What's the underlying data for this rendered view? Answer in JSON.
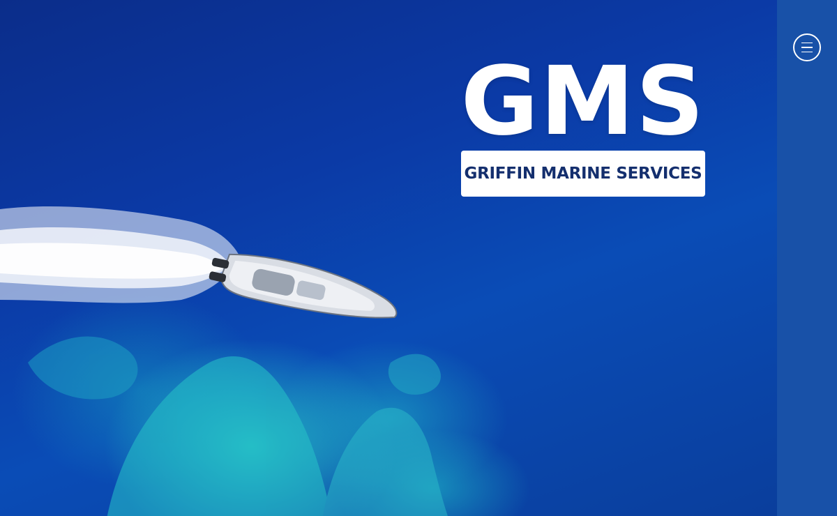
{
  "logo": {
    "mark": "GMS",
    "tagline": "GRIFFIN MARINE SERVICES"
  },
  "hero": {
    "image": "aerial-speedboat-ocean"
  },
  "nav": {
    "menu_icon": "hamburger-menu-icon"
  },
  "colors": {
    "ocean": "#0b3aa6",
    "rail": "#1851a8",
    "banner_text": "#142f6e",
    "white": "#ffffff"
  }
}
